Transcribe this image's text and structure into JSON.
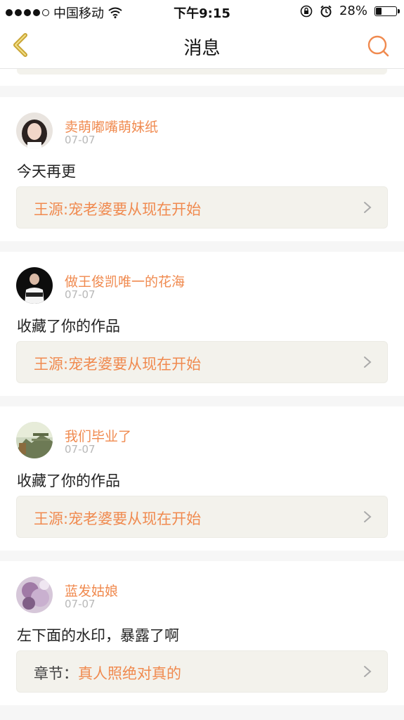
{
  "status_bar": {
    "carrier": "中国移动",
    "time": "下午9:15",
    "battery": "28%",
    "battery_level": 0.28
  },
  "nav": {
    "title": "消息",
    "back_icon": "chevron-left-icon",
    "search_icon": "search-icon"
  },
  "accent_color": "#f08a4f",
  "messages": [
    {
      "username": "卖萌嘟嘴萌妹纸",
      "date": "07-07",
      "text": "今天再更",
      "link_prefix": "",
      "link_text": "王源:宠老婆要从现在开始"
    },
    {
      "username": "做王俊凯唯一的花海",
      "date": "07-07",
      "text": "收藏了你的作品",
      "link_prefix": "",
      "link_text": "王源:宠老婆要从现在开始"
    },
    {
      "username": "我们毕业了",
      "date": "07-07",
      "text": "收藏了你的作品",
      "link_prefix": "",
      "link_text": "王源:宠老婆要从现在开始"
    },
    {
      "username": "蓝发姑娘",
      "date": "07-07",
      "text": "左下面的水印，暴露了啊",
      "link_prefix": "章节：",
      "link_text": "真人照绝对真的"
    }
  ]
}
